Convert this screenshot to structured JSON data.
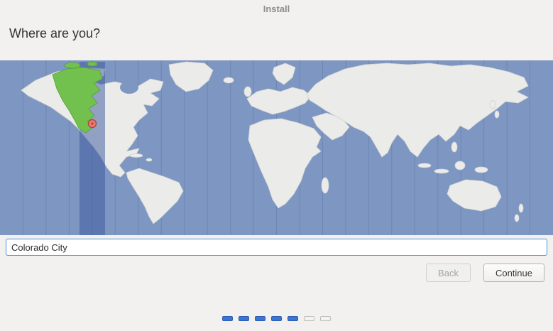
{
  "window": {
    "title": "Install"
  },
  "page": {
    "heading": "Where are you?"
  },
  "map": {
    "ocean_color": "#7e96c2",
    "land_color": "#ebebe9",
    "timezone_highlight_color": "#72c14e",
    "timezone_highlight_stroke": "#55a237",
    "selected_band_color": "rgba(58,86,158,0.5)",
    "pin_fill": "#ee7d74",
    "pin_stroke": "#b2463e",
    "pin_core": "#c6544a"
  },
  "location": {
    "value": "Colorado City"
  },
  "actions": {
    "back_label": "Back",
    "continue_label": "Continue"
  },
  "progress": {
    "total_steps": 7,
    "completed_steps": 5
  }
}
